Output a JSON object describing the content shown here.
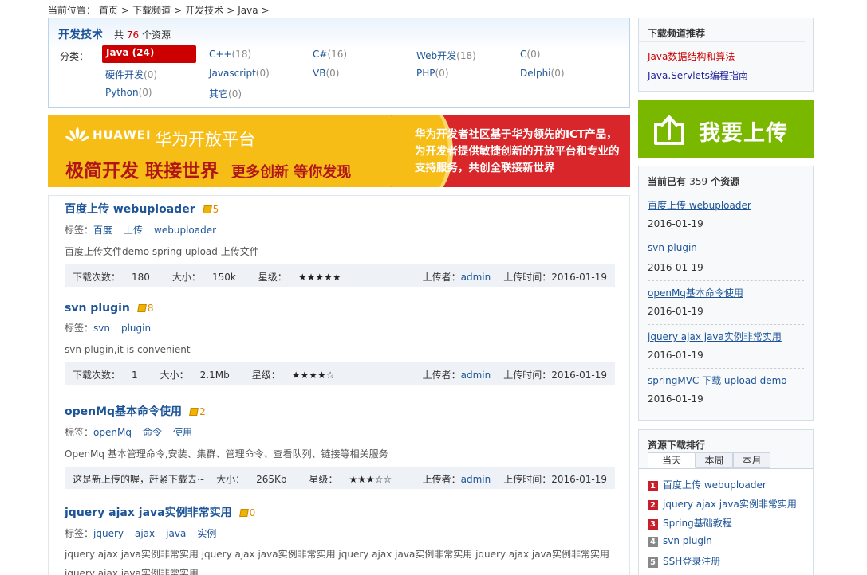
{
  "breadcrumb": {
    "prefix": "当前位置：",
    "items": [
      "首页",
      ">",
      "下载频道",
      ">",
      "开发技术",
      ">",
      "Java",
      ">"
    ]
  },
  "category": {
    "title": "开发技术",
    "total_prefix": "共",
    "total_count": "76",
    "total_suffix": "个资源",
    "label": "分类：",
    "items": [
      {
        "name": "Java",
        "count": "(24)"
      },
      {
        "name": "C++",
        "count": "(18)"
      },
      {
        "name": "C#",
        "count": "(16)"
      },
      {
        "name": "Web开发",
        "count": "(18)"
      },
      {
        "name": "C",
        "count": "(0)"
      },
      {
        "name": "硬件开发",
        "count": "(0)"
      },
      {
        "name": "Javascript",
        "count": "(0)"
      },
      {
        "name": "VB",
        "count": "(0)"
      },
      {
        "name": "PHP",
        "count": "(0)"
      },
      {
        "name": "Delphi",
        "count": "(0)"
      },
      {
        "name": "Python",
        "count": "(0)"
      },
      {
        "name": "其它",
        "count": "(0)"
      }
    ]
  },
  "banner": {
    "brand": "HUAWEI",
    "platform": "华为开放平台",
    "slogan_main": "极简开发  联接世界",
    "slogan_sub": "更多创新  等你发现",
    "desc": "华为开发者社区基于华为领先的ICT产品，为开发者提供敏捷创新的开放平台和专业的支持服务，共创全联接新世界"
  },
  "labels": {
    "tags": "标签：",
    "downloads": "下载次数：",
    "size": "大小：",
    "level": "星级：",
    "uploader": "上传者：",
    "upload_time": "上传时间："
  },
  "resources": [
    {
      "title": "百度上传 webuploader",
      "score": "5",
      "tags": [
        "百度",
        "上传",
        "webuploader"
      ],
      "desc": "百度上传文件demo spring upload 上传文件",
      "downloads": "180",
      "size": "150k",
      "stars": "★★★★★",
      "uploader": "admin",
      "date": "2016-01-19"
    },
    {
      "title": "svn plugin",
      "score": "8",
      "tags": [
        "svn",
        "plugin"
      ],
      "desc": "svn plugin,it is convenient",
      "downloads": "1",
      "size": "2.1Mb",
      "stars": "★★★★☆",
      "uploader": "admin",
      "date": "2016-01-19"
    },
    {
      "title": "openMq基本命令使用",
      "score": "2",
      "tags": [
        "openMq",
        "命令",
        "使用"
      ],
      "desc": "OpenMq 基本管理命令,安装、集群、管理命令、查看队列、链接等相关服务",
      "note": "这是新上传的喔，赶紧下载去~",
      "size": "265Kb",
      "stars": "★★★☆☆",
      "uploader": "admin",
      "date": "2016-01-19"
    },
    {
      "title": "jquery ajax java实例非常实用",
      "score": "0",
      "tags": [
        "jquery",
        "ajax",
        "java",
        "实例"
      ],
      "desc": "jquery ajax java实例非常实用 jquery ajax java实例非常实用 jquery ajax java实例非常实用 jquery ajax java实例非常实用 jquery ajax java实例非常实用"
    }
  ],
  "sidebar": {
    "recommend": {
      "title": "下载频道推荐",
      "links": [
        "Java数据结构和算法",
        "Java.Servlets编程指南"
      ]
    },
    "upload_label": "我要上传",
    "current": {
      "prefix": "当前已有",
      "count": "359",
      "suffix": "个资源",
      "items": [
        {
          "title": "百度上传 webuploader",
          "date": "2016-01-19"
        },
        {
          "title": "svn plugin",
          "date": "2016-01-19"
        },
        {
          "title": "openMq基本命令使用",
          "date": "2016-01-19"
        },
        {
          "title": "jquery ajax java实例非常实用",
          "date": "2016-01-19"
        },
        {
          "title": "springMVC 下载 upload demo",
          "date": "2016-01-19"
        }
      ]
    },
    "ranking": {
      "title": "资源下载排行",
      "tabs": [
        "当天",
        "本周",
        "本月"
      ],
      "items": [
        "百度上传 webuploader",
        "jquery ajax java实例非常实用",
        "Spring基础教程",
        "svn plugin",
        "SSH登录注册"
      ]
    }
  }
}
